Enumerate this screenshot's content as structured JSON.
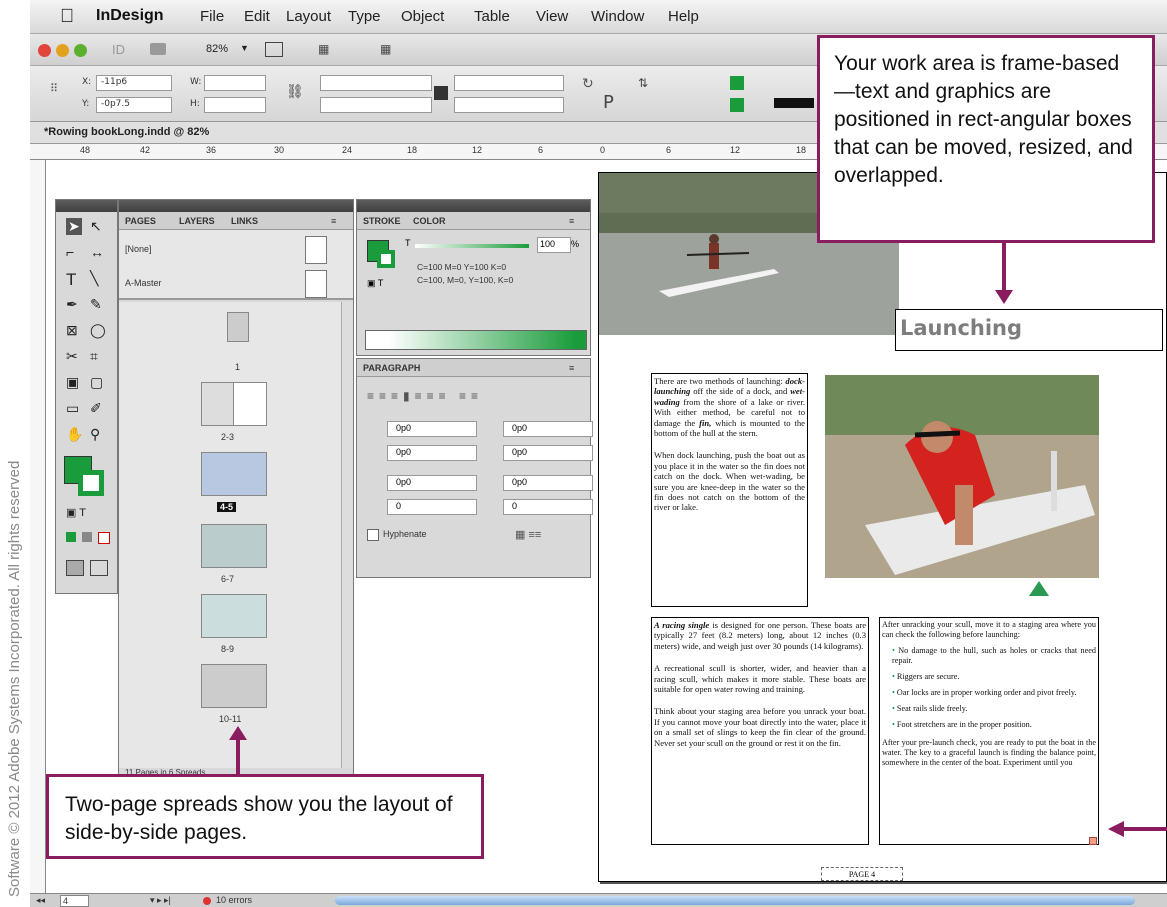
{
  "menubar": {
    "app_name": "InDesign",
    "items": [
      "File",
      "Edit",
      "Layout",
      "Type",
      "Object",
      "Table",
      "View",
      "Window",
      "Help"
    ]
  },
  "control_bar": {
    "zoom": "82%",
    "x_value": "-11p6",
    "y_value": "-0p7.5",
    "x_label": "X:",
    "y_label": "Y:",
    "w_label": "W:",
    "h_label": "H:"
  },
  "document_tab": {
    "title": "*Rowing bookLong.indd @ 82%"
  },
  "ruler": {
    "marks": [
      "48",
      "42",
      "36",
      "30",
      "24",
      "18",
      "12",
      "6",
      "0",
      "6",
      "12",
      "18"
    ]
  },
  "pages_panel": {
    "tabs": [
      "PAGES",
      "LAYERS",
      "LINKS"
    ],
    "none_label": "[None]",
    "master_label": "A-Master",
    "thumb_labels": [
      "1",
      "2-3",
      "4-5",
      "6-7",
      "8-9",
      "10-11"
    ],
    "footer": "11 Pages in 6 Spreads"
  },
  "color_panel": {
    "tabs": [
      "STROKE",
      "COLOR"
    ],
    "tint_label": "T",
    "tint_value": "100",
    "percent": "%",
    "cmyk_line1": "C=100 M=0 Y=100 K=0",
    "cmyk_line2": "C=100, M=0, Y=100, K=0"
  },
  "paragraph_panel": {
    "title": "PARAGRAPH",
    "fields": [
      "0p0",
      "0p0",
      "0p0",
      "0p0",
      "0p0",
      "0p0",
      "0",
      "0"
    ],
    "hyphenate_label": "Hyphenate"
  },
  "layout": {
    "heading": "Launching",
    "col1_p1_pre": "There are two methods of launching: ",
    "col1_p1_term1": "dock-launching",
    "col1_p1_mid": " off the side of a dock, and ",
    "col1_p1_term2": "wet-wading",
    "col1_p1_mid2": " from the shore of a lake or river. With either method, be careful not to damage the ",
    "col1_p1_term3": "fin,",
    "col1_p1_post": " which is mounted to the bottom of the hull at the stern.",
    "col1_p2": "When dock launching, push the boat out as you place it in the water so the fin does not catch on the dock. When wet-wading, be sure you are knee-deep in the water so the fin does not catch on the bottom of the river or lake.",
    "col2_p1_term": "A racing single",
    "col2_p1_rest": " is designed for one person. These boats are typically 27 feet (8.2 meters) long, about 12 inches (0.3 meters) wide, and weigh just over 30 pounds (14 kilograms).",
    "col2_p2": "A recreational scull is shorter, wider, and heavier than a racing scull, which makes it more stable. These boats are suitable for open water rowing and training.",
    "col2_p3": "Think about your staging area before you unrack your boat. If you cannot move your boat directly into the water, place it on a small set of slings to keep the fin clear of the ground. Never set your scull on the ground or rest it on the fin.",
    "col3_intro": "After unracking your scull, move it to a staging area where you can check the following before launching:",
    "col3_bullets": [
      "No damage to the hull, such as holes or cracks that need repair.",
      "Riggers are secure.",
      "Oar locks are in proper working order and pivot freely.",
      "Seat rails slide freely.",
      "Foot stretchers are in the proper position."
    ],
    "col3_p2": "After your pre-launch check, you are ready to put the boat in the water. The key to a graceful launch is finding the balance point, somewhere in the center of the boat. Experiment until you",
    "page_label": "PAGE 4"
  },
  "callouts": {
    "top": "Your work area is frame-based—text and graphics are positioned in rect-angular boxes that can be moved, resized, and overlapped.",
    "bottom": "Two-page spreads show you the layout of side-by-side pages."
  },
  "status": {
    "page": "4",
    "errors": "10 errors"
  },
  "copyright": "Software © 2012 Adobe Systems Incorporated. All rights reserved",
  "colors": {
    "callout_border": "#8a1d5f",
    "accent_green": "#1a9c3c",
    "arrow": "#8a1d5f"
  }
}
